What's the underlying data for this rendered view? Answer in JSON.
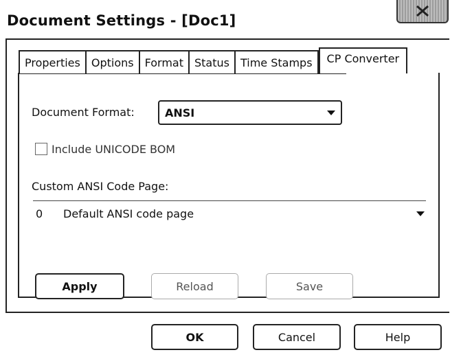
{
  "window": {
    "title": "Document Settings - [Doc1]",
    "close_icon": "close-x-icon"
  },
  "tabs": [
    {
      "label": "Properties",
      "active": false
    },
    {
      "label": "Options",
      "active": false
    },
    {
      "label": "Format",
      "active": false
    },
    {
      "label": "Status",
      "active": false
    },
    {
      "label": "Time Stamps",
      "active": false
    },
    {
      "label": "CP Converter",
      "active": true
    }
  ],
  "cp_converter": {
    "document_format_label": "Document Format:",
    "document_format_value": "ANSI",
    "include_bom_label": "Include UNICODE BOM",
    "include_bom_checked": false,
    "custom_code_page_label": "Custom ANSI Code Page:",
    "code_page_number": "0",
    "code_page_name": "Default ANSI code page",
    "apply_label": "Apply",
    "reload_label": "Reload",
    "save_label": "Save"
  },
  "footer": {
    "ok_label": "OK",
    "cancel_label": "Cancel",
    "help_label": "Help"
  },
  "colors": {
    "border": "#222222",
    "background": "#ffffff",
    "disabled_border": "#aaaaaa"
  }
}
